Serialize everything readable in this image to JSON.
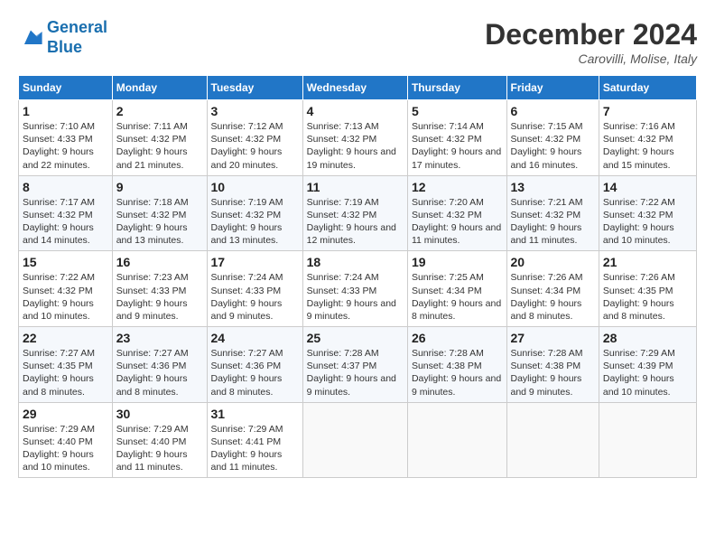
{
  "header": {
    "logo_line1": "General",
    "logo_line2": "Blue",
    "month_title": "December 2024",
    "location": "Carovilli, Molise, Italy"
  },
  "days_of_week": [
    "Sunday",
    "Monday",
    "Tuesday",
    "Wednesday",
    "Thursday",
    "Friday",
    "Saturday"
  ],
  "weeks": [
    [
      {
        "day": "1",
        "sunrise": "7:10 AM",
        "sunset": "4:33 PM",
        "daylight": "9 hours and 22 minutes."
      },
      {
        "day": "2",
        "sunrise": "7:11 AM",
        "sunset": "4:32 PM",
        "daylight": "9 hours and 21 minutes."
      },
      {
        "day": "3",
        "sunrise": "7:12 AM",
        "sunset": "4:32 PM",
        "daylight": "9 hours and 20 minutes."
      },
      {
        "day": "4",
        "sunrise": "7:13 AM",
        "sunset": "4:32 PM",
        "daylight": "9 hours and 19 minutes."
      },
      {
        "day": "5",
        "sunrise": "7:14 AM",
        "sunset": "4:32 PM",
        "daylight": "9 hours and 17 minutes."
      },
      {
        "day": "6",
        "sunrise": "7:15 AM",
        "sunset": "4:32 PM",
        "daylight": "9 hours and 16 minutes."
      },
      {
        "day": "7",
        "sunrise": "7:16 AM",
        "sunset": "4:32 PM",
        "daylight": "9 hours and 15 minutes."
      }
    ],
    [
      {
        "day": "8",
        "sunrise": "7:17 AM",
        "sunset": "4:32 PM",
        "daylight": "9 hours and 14 minutes."
      },
      {
        "day": "9",
        "sunrise": "7:18 AM",
        "sunset": "4:32 PM",
        "daylight": "9 hours and 13 minutes."
      },
      {
        "day": "10",
        "sunrise": "7:19 AM",
        "sunset": "4:32 PM",
        "daylight": "9 hours and 13 minutes."
      },
      {
        "day": "11",
        "sunrise": "7:19 AM",
        "sunset": "4:32 PM",
        "daylight": "9 hours and 12 minutes."
      },
      {
        "day": "12",
        "sunrise": "7:20 AM",
        "sunset": "4:32 PM",
        "daylight": "9 hours and 11 minutes."
      },
      {
        "day": "13",
        "sunrise": "7:21 AM",
        "sunset": "4:32 PM",
        "daylight": "9 hours and 11 minutes."
      },
      {
        "day": "14",
        "sunrise": "7:22 AM",
        "sunset": "4:32 PM",
        "daylight": "9 hours and 10 minutes."
      }
    ],
    [
      {
        "day": "15",
        "sunrise": "7:22 AM",
        "sunset": "4:32 PM",
        "daylight": "9 hours and 10 minutes."
      },
      {
        "day": "16",
        "sunrise": "7:23 AM",
        "sunset": "4:33 PM",
        "daylight": "9 hours and 9 minutes."
      },
      {
        "day": "17",
        "sunrise": "7:24 AM",
        "sunset": "4:33 PM",
        "daylight": "9 hours and 9 minutes."
      },
      {
        "day": "18",
        "sunrise": "7:24 AM",
        "sunset": "4:33 PM",
        "daylight": "9 hours and 9 minutes."
      },
      {
        "day": "19",
        "sunrise": "7:25 AM",
        "sunset": "4:34 PM",
        "daylight": "9 hours and 8 minutes."
      },
      {
        "day": "20",
        "sunrise": "7:26 AM",
        "sunset": "4:34 PM",
        "daylight": "9 hours and 8 minutes."
      },
      {
        "day": "21",
        "sunrise": "7:26 AM",
        "sunset": "4:35 PM",
        "daylight": "9 hours and 8 minutes."
      }
    ],
    [
      {
        "day": "22",
        "sunrise": "7:27 AM",
        "sunset": "4:35 PM",
        "daylight": "9 hours and 8 minutes."
      },
      {
        "day": "23",
        "sunrise": "7:27 AM",
        "sunset": "4:36 PM",
        "daylight": "9 hours and 8 minutes."
      },
      {
        "day": "24",
        "sunrise": "7:27 AM",
        "sunset": "4:36 PM",
        "daylight": "9 hours and 8 minutes."
      },
      {
        "day": "25",
        "sunrise": "7:28 AM",
        "sunset": "4:37 PM",
        "daylight": "9 hours and 9 minutes."
      },
      {
        "day": "26",
        "sunrise": "7:28 AM",
        "sunset": "4:38 PM",
        "daylight": "9 hours and 9 minutes."
      },
      {
        "day": "27",
        "sunrise": "7:28 AM",
        "sunset": "4:38 PM",
        "daylight": "9 hours and 9 minutes."
      },
      {
        "day": "28",
        "sunrise": "7:29 AM",
        "sunset": "4:39 PM",
        "daylight": "9 hours and 10 minutes."
      }
    ],
    [
      {
        "day": "29",
        "sunrise": "7:29 AM",
        "sunset": "4:40 PM",
        "daylight": "9 hours and 10 minutes."
      },
      {
        "day": "30",
        "sunrise": "7:29 AM",
        "sunset": "4:40 PM",
        "daylight": "9 hours and 11 minutes."
      },
      {
        "day": "31",
        "sunrise": "7:29 AM",
        "sunset": "4:41 PM",
        "daylight": "9 hours and 11 minutes."
      },
      null,
      null,
      null,
      null
    ]
  ]
}
